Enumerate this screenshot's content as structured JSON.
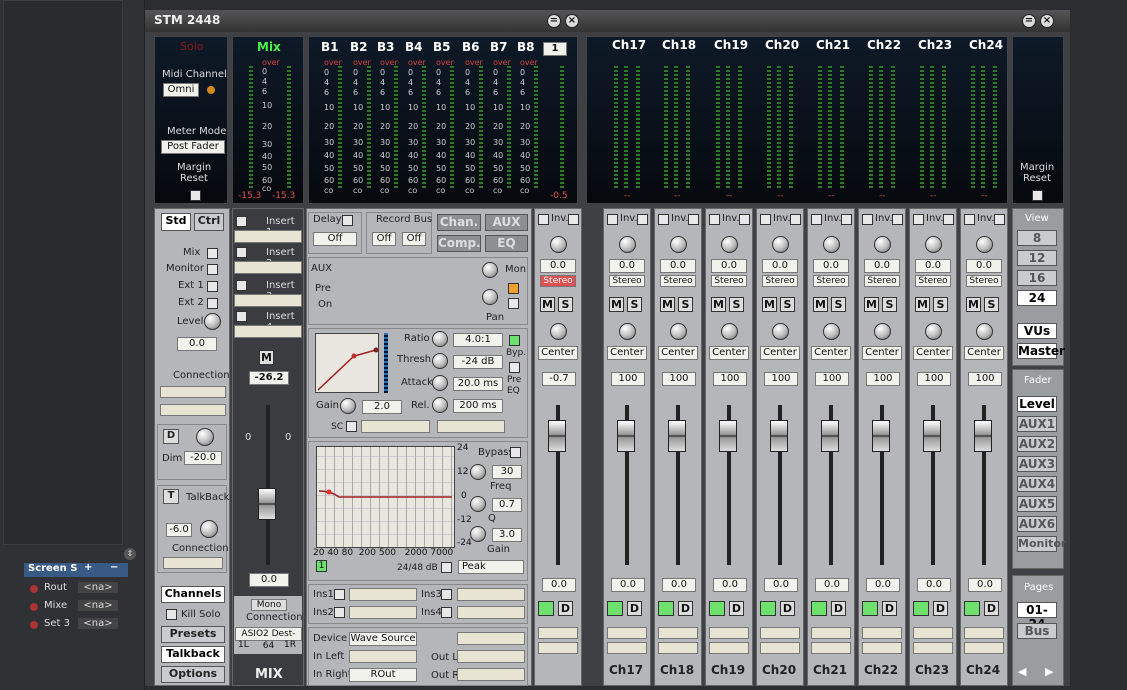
{
  "window": {
    "title": "STM 2448"
  },
  "left": {
    "screens_label": "Screen S",
    "plus": "+",
    "minus": "−",
    "items": [
      {
        "name": "Rout",
        "value": "<na>"
      },
      {
        "name": "Mixe",
        "value": "<na>"
      },
      {
        "name": "Set 3",
        "value": "<na>"
      }
    ]
  },
  "top": {
    "solo": "Solo",
    "midi_channel_label": "Midi Channel",
    "midi_channel_value": "Omni",
    "meter_mode_label": "Meter Mode",
    "meter_mode_value": "Post Fader",
    "margin_reset": "Margin Reset",
    "mix_label": "Mix",
    "mix_levels": [
      "-15.3",
      "-15.3"
    ],
    "bus_labels": [
      "B1",
      "B2",
      "B3",
      "B4",
      "B5",
      "B6",
      "B7",
      "B8"
    ],
    "bus_page": "1",
    "bus_peak": "-0.5",
    "scale": [
      "over",
      "0",
      "4",
      "6",
      "10",
      "20",
      "30",
      "40",
      "50",
      "60",
      "co"
    ],
    "ch_labels": [
      "Ch17",
      "Ch18",
      "Ch19",
      "Ch20",
      "Ch21",
      "Ch22",
      "Ch23",
      "Ch24"
    ],
    "ch_peak": "--"
  },
  "controls": {
    "std": "Std",
    "ctrl": "Ctrl",
    "mix": "Mix",
    "monitor": "Monitor",
    "ext1": "Ext 1",
    "ext2": "Ext 2",
    "level": "Level",
    "level_value": "0.0",
    "connection": "Connection",
    "dim_btn": "D",
    "dim": "Dim",
    "dim_value": "-20.0",
    "talkback_btn": "T",
    "talkback": "TalkBack",
    "tb_value": "-6.0",
    "tb_conn": "Connection",
    "channels": "Channels",
    "kill_solo": "Kill Solo",
    "presets": "Presets",
    "talkback_btn2": "Talkback",
    "options": "Options"
  },
  "inserts": [
    "Insert 1",
    "Insert 2",
    "Insert 3",
    "Insert 4"
  ],
  "master": {
    "m": "M",
    "value_top": "-26.2",
    "scale0a": "0",
    "scale0b": "0",
    "value_bottom": "0.0",
    "mono": "Mono",
    "connection": "Connection",
    "asio": "ASIO2 Dest-64",
    "left_out": "1L",
    "right_out": "1R",
    "mix": "MIX"
  },
  "strip": {
    "delay": "Delay",
    "delay_value": "Off",
    "record_bus": "Record Bus",
    "rb_value1": "Off",
    "rb_value2": "Off",
    "chan": "Chan.",
    "aux": "AUX",
    "comp": "Comp.",
    "eq": "EQ",
    "aux_label": "AUX",
    "mon": "Mon",
    "pre": "Pre",
    "on": "On",
    "pan": "Pan",
    "aux_nums": [
      "1",
      "2",
      "3",
      "4",
      "5",
      "6"
    ],
    "ratio": "Ratio",
    "ratio_value": "4.0:1",
    "thresh": "Thresh.",
    "thresh_value": "-24 dB",
    "attack": "Attack",
    "attack_value": "20.0 ms",
    "rel": "Rel.",
    "rel_value": "200 ms",
    "gain": "Gain",
    "gain_value": "2.0",
    "byp": "Byp.",
    "pre_eq": "Pre EQ",
    "sc": "SC",
    "eq_bypass": "Bypass",
    "freq": "Freq",
    "freq_value": "30",
    "q": "Q",
    "q_value": "0.7",
    "eq_gain": "Gain",
    "eq_gain_value": "3.0",
    "eq_db_top": "24",
    "eq_db_12": "12",
    "eq_db_0": "0",
    "eq_db_m12": "-12",
    "eq_db_m24": "-24",
    "eq_freqs": "20 40 80  200 500   2000 7000",
    "eq_one": "1",
    "range": "24/48 dB",
    "peak": "Peak",
    "ins1": "Ins1",
    "ins2": "Ins2",
    "ins3": "Ins3",
    "ins4": "Ins4",
    "device": "Device",
    "device_value": "Wave Source",
    "in_left": "In Left",
    "in_right": "In Right",
    "in_right_value": "ROut",
    "out_l": "Out L",
    "out_r": "Out R"
  },
  "channel": {
    "inv": "Inv.",
    "gain": "0.0",
    "stereo": "Stereo",
    "m": "M",
    "s": "S",
    "pan": "Center",
    "vol": "100",
    "fader": "0.0",
    "d": "D",
    "first_vol": "-0.7",
    "page": "1"
  },
  "right": {
    "view": "View",
    "view_opts": [
      "8",
      "12",
      "16",
      "24"
    ],
    "vus": "VUs",
    "master": "Master",
    "fader": "Fader",
    "fader_opts": [
      "Level",
      "AUX1",
      "AUX2",
      "AUX3",
      "AUX4",
      "AUX5",
      "AUX6",
      "Monitor"
    ],
    "pages": "Pages",
    "pages_value": "01-24",
    "bus": "Bus",
    "prev": "◀",
    "next": "▶"
  }
}
